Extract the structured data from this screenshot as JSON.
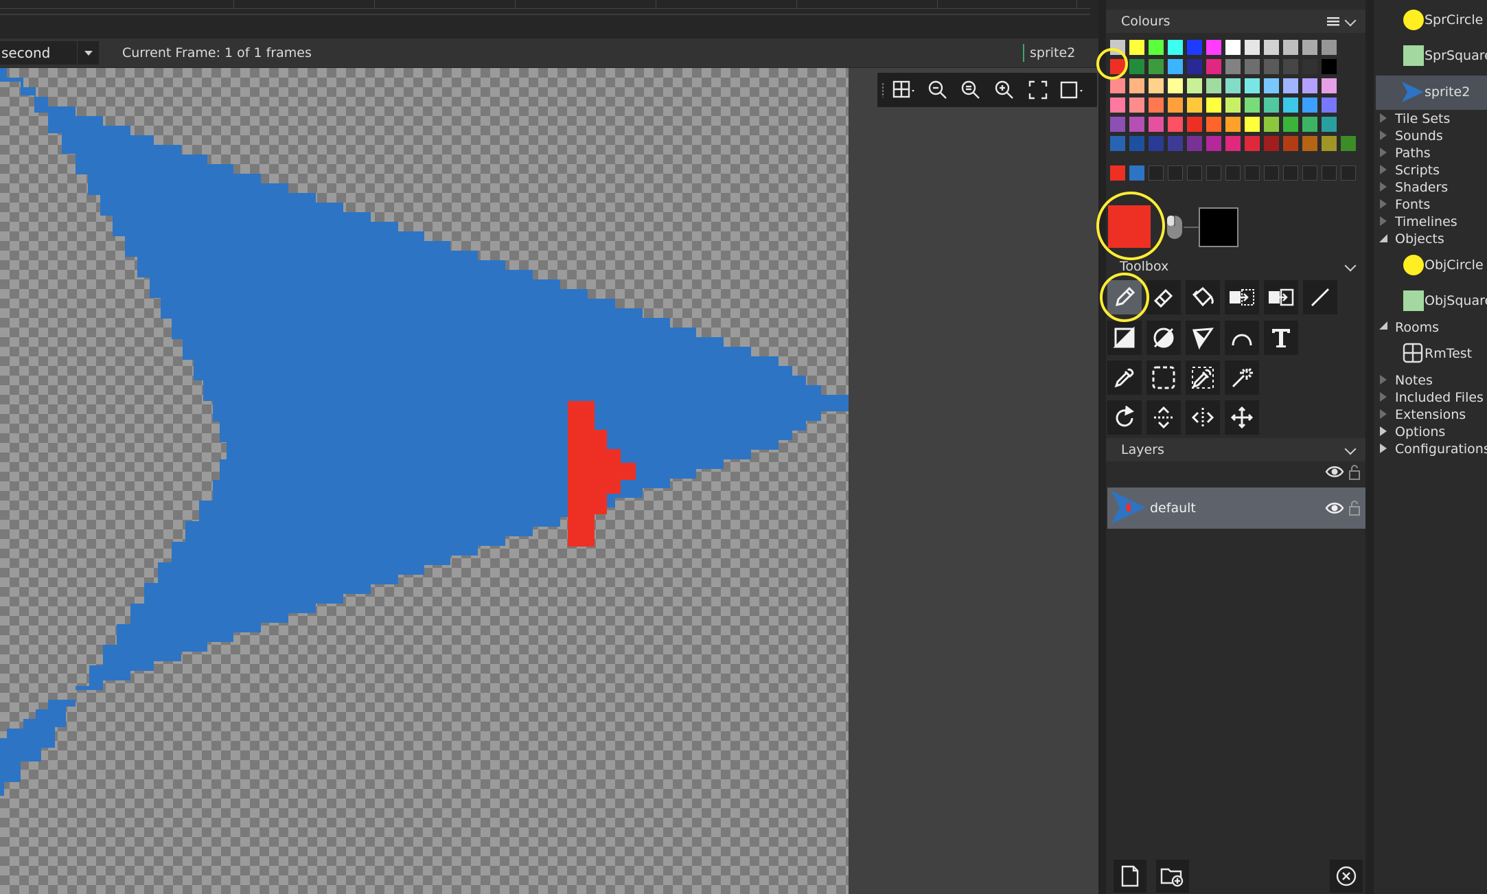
{
  "frame_bar": {
    "animation_select_value": "second",
    "frame_info": "Current Frame: 1 of 1 frames",
    "sprite_tab": "sprite2"
  },
  "canvas": {
    "primary_sprite_color": "#2d74c4",
    "mark_color": "#ee3024",
    "checker_dark": "#7a7a7a",
    "checker_light": "#9b9b9b"
  },
  "canvas_toolbar": {
    "buttons": [
      "grid-toggle-icon",
      "zoom-out-icon",
      "zoom-reset-icon",
      "zoom-in-icon",
      "fit-screen-icon",
      "background-icon"
    ]
  },
  "colours": {
    "title": "Colours",
    "palette_rows": [
      [
        "#c8c8c8",
        "#ffff3c",
        "#5cff3c",
        "#3cfff0",
        "#1e3cff",
        "#ff3cff",
        "#ffffff",
        "#e6e6e6",
        "#d2d2d2",
        "#bebebe",
        "#aaaaaa",
        "#969696"
      ],
      [
        "#ee3024",
        "#228c3c",
        "#3c9b3c",
        "#3cb4ff",
        "#282896",
        "#e02882",
        "#828282",
        "#6e6e6e",
        "#5a5a5a",
        "#464646",
        "#323232",
        "#000000"
      ],
      [
        "#ff8c8c",
        "#ffb482",
        "#ffd28c",
        "#ffff96",
        "#c8f096",
        "#a0dca0",
        "#82dcc8",
        "#78e6e6",
        "#78c8ff",
        "#a0b4ff",
        "#b4a0ff",
        "#e6a0e6"
      ],
      [
        "#ff78a0",
        "#ff8c8c",
        "#ff7850",
        "#ffa03c",
        "#ffc83c",
        "#ffff3c",
        "#c8f064",
        "#78dc78",
        "#50c8a0",
        "#3cc8e6",
        "#3ca0ff",
        "#7878ff"
      ],
      [
        "#8c50b4",
        "#b450b4",
        "#e650a0",
        "#ff5064",
        "#ee3024",
        "#ff6428",
        "#ffa028",
        "#ffff3c",
        "#8cc83c",
        "#3cb43c",
        "#3cb464",
        "#28a0a0"
      ],
      [
        "#2864b4",
        "#1e50a0",
        "#283c96",
        "#3c3c96",
        "#783296",
        "#b4289b",
        "#e0287d",
        "#e0283c",
        "#a01e1e",
        "#b43c14",
        "#b46414",
        "#a09628",
        "#3c8c28"
      ]
    ],
    "recent_colours": [
      "#ee3024",
      "#2d74c4"
    ],
    "primary_colour": "#ee3024",
    "secondary_colour": "#000000"
  },
  "toolbox": {
    "title": "Toolbox",
    "tools": [
      "pencil-icon",
      "eraser-icon",
      "fill-bucket-icon",
      "copy-selection-icon",
      "paste-selection-icon",
      "line-icon",
      "rectangle-icon",
      "ellipse-icon",
      "polygon-icon",
      "curve-icon",
      "text-icon",
      "color-picker-icon",
      "rect-select-icon",
      "lasso-select-icon",
      "magic-wand-icon",
      "rotate-icon",
      "flip-vertical-icon",
      "flip-horizontal-icon",
      "move-icon"
    ]
  },
  "layers": {
    "title": "Layers",
    "items": [
      {
        "name": "default",
        "visible": true,
        "locked": false
      }
    ]
  },
  "asset_tree": {
    "items": [
      {
        "label": "SprCircle",
        "type": "sprite",
        "icon": "circle-sprite-icon"
      },
      {
        "label": "SprSquare",
        "type": "sprite",
        "icon": "square-sprite-icon"
      },
      {
        "label": "sprite2",
        "type": "sprite",
        "icon": "arrow-sprite-icon",
        "selected": true
      },
      {
        "label": "Tile Sets",
        "type": "folder"
      },
      {
        "label": "Sounds",
        "type": "folder"
      },
      {
        "label": "Paths",
        "type": "folder"
      },
      {
        "label": "Scripts",
        "type": "folder"
      },
      {
        "label": "Shaders",
        "type": "folder"
      },
      {
        "label": "Fonts",
        "type": "folder"
      },
      {
        "label": "Timelines",
        "type": "folder"
      },
      {
        "label": "Objects",
        "type": "folder",
        "expanded": true
      },
      {
        "label": "ObjCircle",
        "type": "object",
        "icon": "circle-object-icon"
      },
      {
        "label": "ObjSquare",
        "type": "object",
        "icon": "square-object-icon"
      },
      {
        "label": "Rooms",
        "type": "folder",
        "expanded": true
      },
      {
        "label": "RmTest",
        "type": "room",
        "icon": "room-icon"
      },
      {
        "label": "Notes",
        "type": "folder"
      },
      {
        "label": "Included Files",
        "type": "folder"
      },
      {
        "label": "Extensions",
        "type": "folder"
      },
      {
        "label": "Options",
        "type": "folder"
      },
      {
        "label": "Configurations",
        "type": "folder"
      }
    ]
  }
}
